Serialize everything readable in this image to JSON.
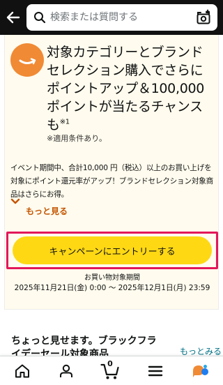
{
  "header": {
    "back_icon": "back-arrow-icon",
    "search": {
      "placeholder": "検索または質問する",
      "value": ""
    },
    "camera_icon": "camera-scan-icon"
  },
  "promo": {
    "title": "対象カテゴリーとブランドセレクション購入でさらに ポイントアップ＆100,000ポイントが当たるチャンスも",
    "title_note": "※1",
    "conditions": "※適用条件あり。",
    "description": "イベント期間中、合計10,000 円（税込）以上のお買い上げを対象にポイント還元率がアップ！ブランドセレクション対象商品はさらにお得。",
    "more_label": "もっと見る",
    "entry_button": "キャンペーンにエントリーする",
    "period_label": "お買い物対象期間",
    "period_value": "2025年11月21日(金) 0:00 〜 2025年12月1日(月) 23:59",
    "logo_color": "#f08a35"
  },
  "section": {
    "title": "ちょっと見せます。ブラックフライデーセール対象商品",
    "see_more": "もっとみる"
  },
  "bottom_nav": {
    "items": [
      {
        "icon": "home-icon"
      },
      {
        "icon": "account-icon"
      },
      {
        "icon": "cart-icon",
        "count": "0"
      },
      {
        "icon": "menu-icon"
      },
      {
        "icon": "rufus-chat-icon"
      }
    ]
  },
  "colors": {
    "header_bg": "#111111",
    "entry_button": "#ffd814",
    "highlight_border": "#e3175a",
    "link": "#007185",
    "more": "#c45500"
  }
}
